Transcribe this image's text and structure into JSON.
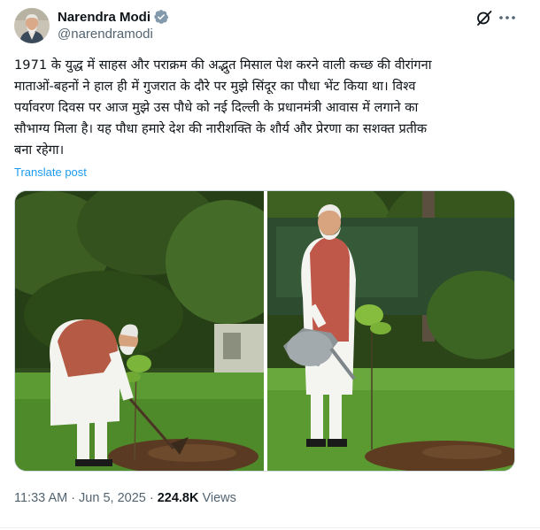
{
  "author": {
    "name": "Narendra Modi",
    "handle": "@narendramodi",
    "verified_color": "#829aab"
  },
  "post": {
    "lines": [
      "1971 के युद्ध में साहस और पराक्रम की अद्भुत मिसाल पेश करने वाली कच्छ की वीरांगना",
      "माताओं-बहनों ने हाल ही में गुजरात के दौरे पर मुझे सिंदूर का पौधा भेंट किया था। विश्व",
      "पर्यावरण दिवस पर आज मुझे उस पौधे को नई दिल्ली के प्रधानमंत्री आवास में लगाने का",
      "सौभाग्य मिला है। यह पौधा हमारे देश की नारीशक्ति के शौर्य और प्रेरणा का सशक्त प्रतीक",
      "बना रहेगा।"
    ],
    "translate_label": "Translate post"
  },
  "meta": {
    "time": "11:33 AM",
    "dot": "·",
    "date": "Jun 5, 2025",
    "views_count": "224.8K",
    "views_label": "Views"
  },
  "icons": {
    "grok": "grok-icon",
    "more": "more-icon",
    "verified": "verified-badge-icon"
  },
  "colors": {
    "link": "#1d9bf0",
    "secondary_text": "#536471",
    "primary_text": "#0f1419"
  }
}
